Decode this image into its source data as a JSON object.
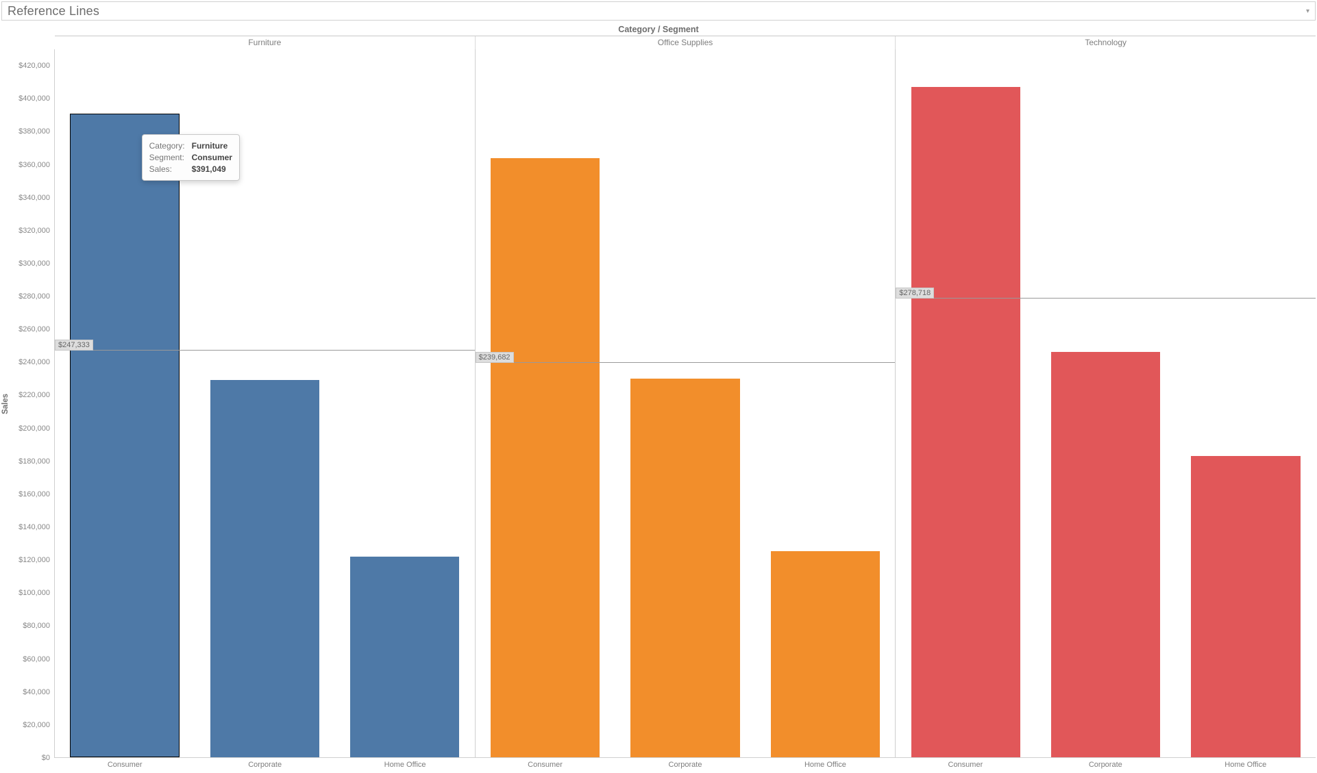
{
  "title": "Reference Lines",
  "top_axis_title": "Category / Segment",
  "ylabel": "Sales",
  "y_axis": {
    "min": 0,
    "max": 430000,
    "ticks": [
      0,
      20000,
      40000,
      60000,
      80000,
      100000,
      120000,
      140000,
      160000,
      180000,
      200000,
      220000,
      240000,
      260000,
      280000,
      300000,
      320000,
      340000,
      360000,
      380000,
      400000,
      420000
    ],
    "tick_labels": [
      "$0",
      "$20,000",
      "$40,000",
      "$60,000",
      "$80,000",
      "$100,000",
      "$120,000",
      "$140,000",
      "$160,000",
      "$180,000",
      "$200,000",
      "$220,000",
      "$240,000",
      "$260,000",
      "$280,000",
      "$300,000",
      "$320,000",
      "$340,000",
      "$360,000",
      "$380,000",
      "$400,000",
      "$420,000"
    ]
  },
  "categories": [
    "Furniture",
    "Office Supplies",
    "Technology"
  ],
  "segments": [
    "Consumer",
    "Corporate",
    "Home Office"
  ],
  "colors": {
    "Furniture": "#4e79a7",
    "Office Supplies": "#f28e2b",
    "Technology": "#e15759"
  },
  "reference_lines": [
    {
      "category": "Furniture",
      "value": 247333,
      "label": "$247,333"
    },
    {
      "category": "Office Supplies",
      "value": 239682,
      "label": "$239,682"
    },
    {
      "category": "Technology",
      "value": 278718,
      "label": "$278,718"
    }
  ],
  "tooltip": {
    "rows": [
      {
        "k": "Category:",
        "v": "Furniture"
      },
      {
        "k": "Segment:",
        "v": "Consumer"
      },
      {
        "k": "Sales:",
        "v": "$391,049"
      }
    ],
    "panel_index": 0,
    "bar_index": 0
  },
  "chart_data": {
    "type": "bar",
    "title": "Reference Lines",
    "xlabel": "Category / Segment",
    "ylabel": "Sales",
    "ylim": [
      0,
      430000
    ],
    "categories": [
      "Consumer",
      "Corporate",
      "Home Office"
    ],
    "facets": [
      "Furniture",
      "Office Supplies",
      "Technology"
    ],
    "series": [
      {
        "name": "Furniture",
        "values": [
          391049,
          229000,
          122000
        ]
      },
      {
        "name": "Office Supplies",
        "values": [
          364000,
          230000,
          125000
        ]
      },
      {
        "name": "Technology",
        "values": [
          407000,
          246000,
          183000
        ]
      }
    ],
    "reference_lines": {
      "Furniture": 247333,
      "Office Supplies": 239682,
      "Technology": 278718
    }
  }
}
